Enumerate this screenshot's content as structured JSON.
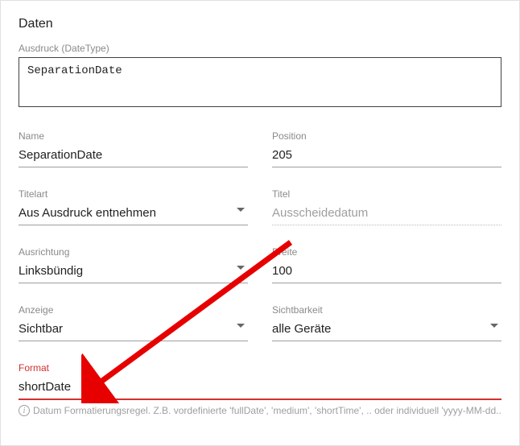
{
  "section_title": "Daten",
  "expression": {
    "label": "Ausdruck (DateType)",
    "value": "SeparationDate"
  },
  "fields": {
    "name": {
      "label": "Name",
      "value": "SeparationDate"
    },
    "position": {
      "label": "Position",
      "value": "205"
    },
    "titleart": {
      "label": "Titelart",
      "value": "Aus Ausdruck entnehmen"
    },
    "titel": {
      "label": "Titel",
      "value": "Ausscheidedatum"
    },
    "ausrichtung": {
      "label": "Ausrichtung",
      "value": "Linksbündig"
    },
    "breite": {
      "label": "Breite",
      "value": "100"
    },
    "anzeige": {
      "label": "Anzeige",
      "value": "Sichtbar"
    },
    "sichtbarkeit": {
      "label": "Sichtbarkeit",
      "value": "alle Geräte"
    },
    "format": {
      "label": "Format",
      "value": "shortDate",
      "helper": "Datum Formatierungsregel. Z.B. vordefinierte 'fullDate', 'medium', 'shortTime', .. oder individuell 'yyyy-MM-dd..."
    }
  },
  "colors": {
    "error": "#d32f2f"
  }
}
